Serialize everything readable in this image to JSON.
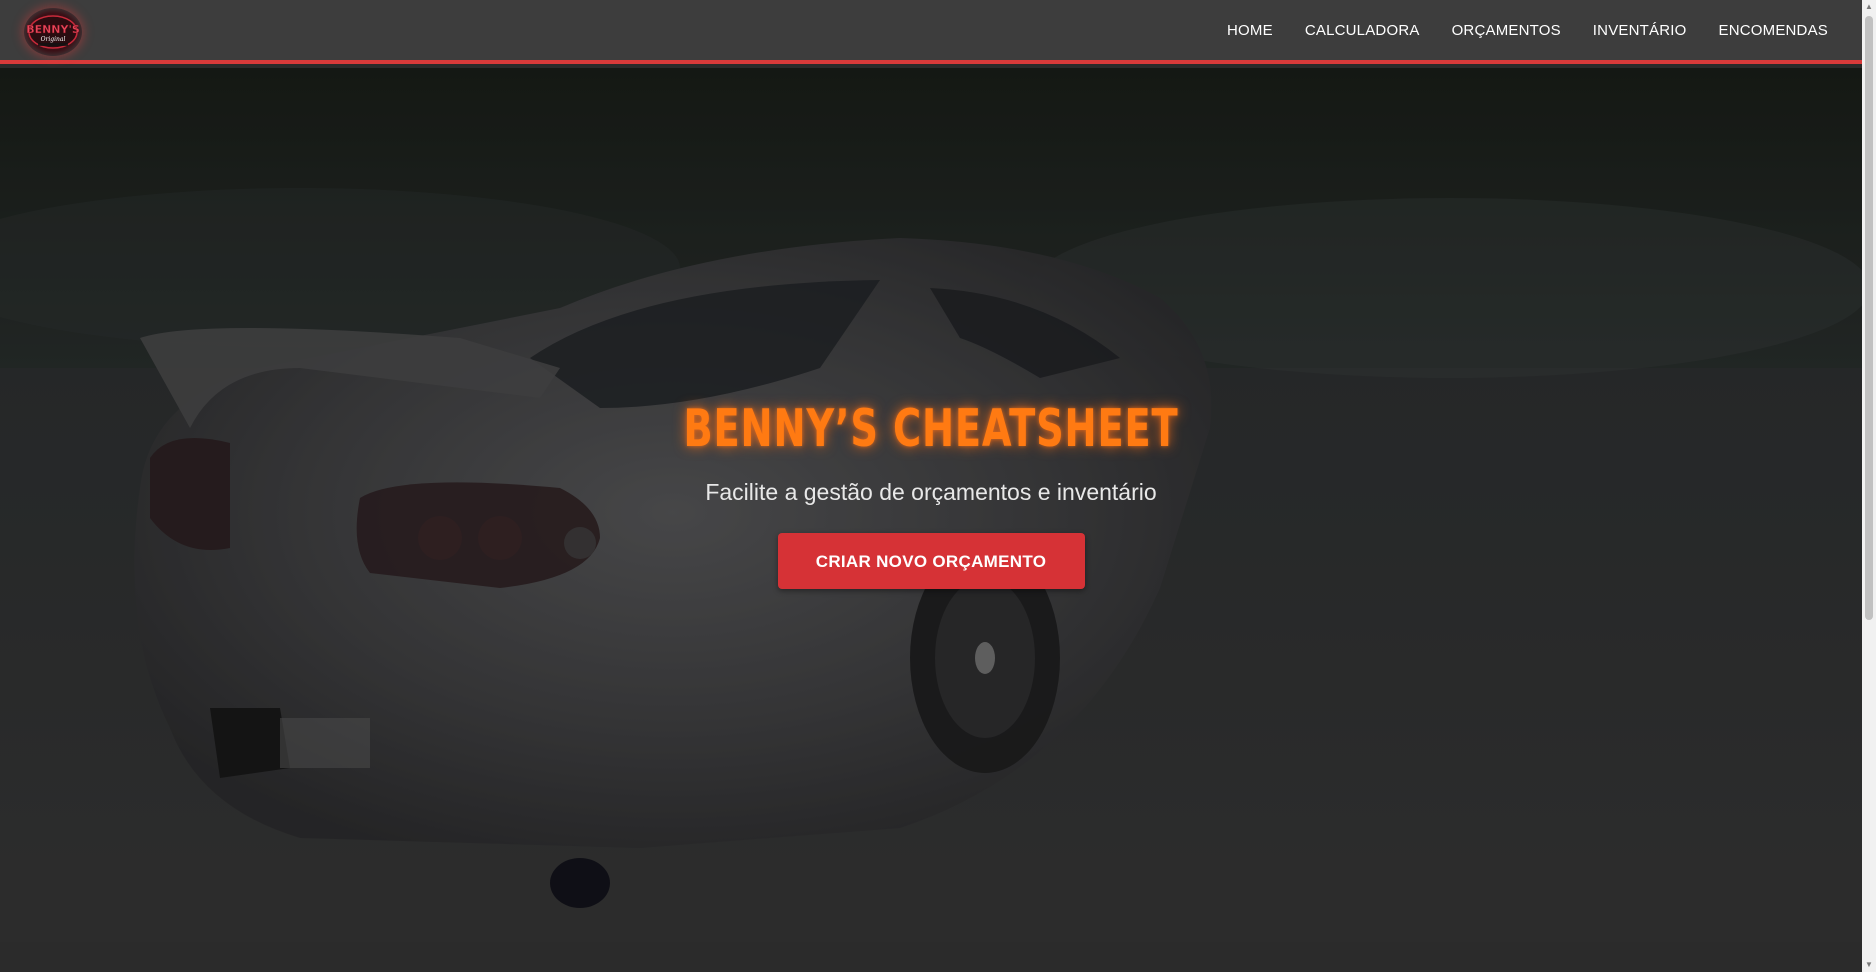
{
  "brand": {
    "logo_text": "BENNY'S",
    "logo_subtext": "Original"
  },
  "nav": {
    "items": [
      {
        "label": "HOME"
      },
      {
        "label": "CALCULADORA"
      },
      {
        "label": "ORÇAMENTOS"
      },
      {
        "label": "INVENTÁRIO"
      },
      {
        "label": "ENCOMENDAS"
      }
    ]
  },
  "hero": {
    "title": "BENNY’S CHEATSHEET",
    "subtitle": "Facilite a gestão de orçamentos e inventário",
    "cta_label": "CRIAR NOVO ORÇAMENTO"
  },
  "colors": {
    "navbar_bg": "#3d3d3d",
    "accent_red": "#d83a3a",
    "title_orange": "#ff7a12",
    "button_red": "#d63236"
  }
}
